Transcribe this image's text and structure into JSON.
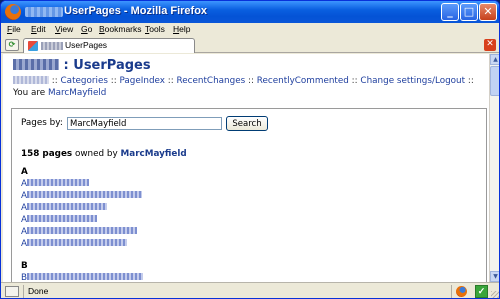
{
  "window": {
    "title": "UserPages - Mozilla Firefox",
    "title_prefix_blurred": true
  },
  "window_controls": {
    "minimize": "_",
    "maximize": "□",
    "close": "✕"
  },
  "menu": [
    {
      "label": "File",
      "accel": "F",
      "rest": "ile"
    },
    {
      "label": "Edit",
      "accel": "E",
      "rest": "dit"
    },
    {
      "label": "View",
      "accel": "V",
      "rest": "iew"
    },
    {
      "label": "Go",
      "accel": "G",
      "rest": "o"
    },
    {
      "label": "Bookmarks",
      "accel": "B",
      "rest": "ookmarks"
    },
    {
      "label": "Tools",
      "accel": "T",
      "rest": "ools"
    },
    {
      "label": "Help",
      "accel": "H",
      "rest": "elp"
    }
  ],
  "tab": {
    "label": "UserPages",
    "new_tab_glyph": "⟳",
    "close_glyph": "✕"
  },
  "page": {
    "title_sep": " : ",
    "title": "UserPages",
    "nav": [
      {
        "label": "Categories"
      },
      {
        "label": "PageIndex"
      },
      {
        "label": "RecentChanges"
      },
      {
        "label": "RecentlyCommented"
      },
      {
        "label": "Change settings/Logout"
      }
    ],
    "nav_sep": " :: ",
    "you_are_prefix": "You are ",
    "username": "MarcMayfield"
  },
  "search": {
    "label": "Pages by:",
    "value": "MarcMayfield",
    "button": "Search"
  },
  "summary": {
    "count": "158 pages",
    "owned_by": " owned by ",
    "owner": "MarcMayfield"
  },
  "groups": [
    {
      "letter": "A",
      "links": [
        {
          "first": "A",
          "blur_len": 62
        },
        {
          "first": "A",
          "blur_len": 115
        },
        {
          "first": "A",
          "blur_len": 80
        },
        {
          "first": "A",
          "blur_len": 70
        },
        {
          "first": "A",
          "blur_len": 110
        },
        {
          "first": "A",
          "blur_len": 100
        }
      ]
    },
    {
      "letter": "B",
      "links": [
        {
          "first": "B",
          "blur_len": 116
        }
      ]
    }
  ],
  "status": {
    "text": "Done"
  },
  "colors": {
    "title_bar": "#0453d6",
    "link": "#1f3f9e",
    "heading": "#1a3b8c"
  }
}
